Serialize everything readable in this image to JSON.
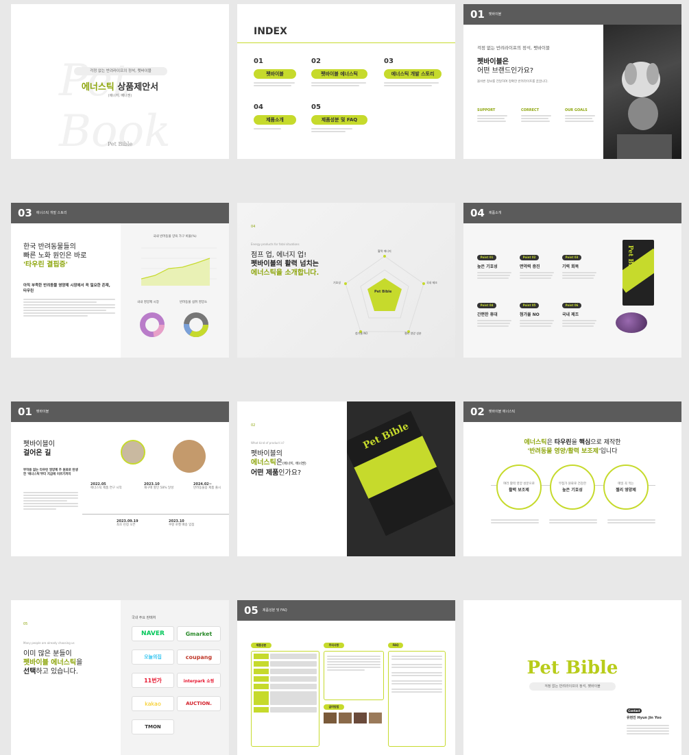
{
  "s1": {
    "tagline": "걱정 없는 반려라이프의 정석, 펫바이블",
    "title_hl": "에너스틱",
    "title_rest": " 상품제안서",
    "subtitle": "(에너지, 에너젠)",
    "brand": "Pet Bible"
  },
  "s2": {
    "title": "INDEX",
    "items": [
      {
        "num": "01",
        "label": "펫바이블"
      },
      {
        "num": "02",
        "label": "펫바이블 에너스틱"
      },
      {
        "num": "03",
        "label": "에너스틱 개발 스토리"
      },
      {
        "num": "04",
        "label": "제품소개"
      },
      {
        "num": "05",
        "label": "제품성분 및 FAQ"
      }
    ]
  },
  "s3": {
    "num": "01",
    "hdr_sub": "펫바이블",
    "tagline": "걱정 없는 반려라이프의 정석, 펫바이블",
    "q1": "펫바이블은",
    "q2": "어떤 브랜드인가요?",
    "desc": "올바른 정보를 전달하여 정확한 반려라이프를 꿈꿉니다.",
    "cols": [
      "SUPPORT",
      "CORRECT",
      "OUR GOALS"
    ]
  },
  "s4": {
    "num": "03",
    "hdr_sub": "에너스틱 개발 스토리",
    "h1": "한국 반려동물들의",
    "h2": "빠른 노화 원인은 바로",
    "h3": "'타우린 결핍증'",
    "sub": "아직 부족한 반려동물 영양제 시장에서 꼭 필요한 존재, 타우린",
    "chart_title": "국내 반려동물 양육 가구 비율(%)",
    "pie1": "국내 영양제 시장",
    "pie2": "반려동물 섭취 영양소"
  },
  "s5": {
    "num": "04",
    "eyebrow": "Energy products for fatal situations",
    "l1": "점프 업, 에너지 업!",
    "l2": "펫바이블의 활력 넘치는",
    "l3": "에너스틱을 소개합니다.",
    "center": "Pet Bible",
    "axes": [
      "활력 에너지",
      "국내 제조",
      "젤리 영양 성분",
      "첨가물 NO",
      "기호성"
    ]
  },
  "s6": {
    "num": "04",
    "hdr_sub": "제품소개",
    "points": [
      {
        "tag": "Point 01",
        "title": "높은 기호성"
      },
      {
        "tag": "Point 02",
        "title": "면역력 증진"
      },
      {
        "tag": "Point 03",
        "title": "기력 회복"
      },
      {
        "tag": "Point 04",
        "title": "간편한 휴대"
      },
      {
        "tag": "Point 05",
        "title": "첨가물 NO"
      },
      {
        "tag": "Point 06",
        "title": "국내 제조"
      }
    ],
    "pkg": "Pet Bible"
  },
  "s7": {
    "num": "01",
    "hdr_sub": "펫바이블",
    "t1": "펫바이블이",
    "t2": "걸어온 길",
    "sub": "부작용 없는 타우린 영양제 주 원료로 탄생한 '에너스틱'부터 지금에 이르기까지",
    "events": [
      {
        "date": "2022.05",
        "text": "에너스틱 제품 연구 시작"
      },
      {
        "date": "2023.10",
        "text": "재구매 할인 58% 달성"
      },
      {
        "date": "2024.02~",
        "text": "반려동물용 제품 출시"
      },
      {
        "date": "2023.09.19",
        "text": "최초 런칭 오픈"
      },
      {
        "date": "2023.10",
        "text": "쿠팡 로켓 배송 입점"
      }
    ]
  },
  "s8": {
    "num": "02",
    "eyebrow": "What kind of product is?",
    "l1": "펫바이블의",
    "l2": "에너스틱",
    "l2b": "은",
    "l2c": "(에너지, 에너젠)",
    "l3": "어떤 제품",
    "l3b": "인가요?",
    "pkg": "Pet Bible"
  },
  "s9": {
    "num": "02",
    "hdr_sub": "펫바이블 에너스틱",
    "h1a": "에너스틱",
    "h1b": "은 ",
    "h1c": "타우린",
    "h1d": "을 ",
    "h1e": "핵심",
    "h1f": "으로 제작한",
    "h2": "'반려동물 영양/활력 보조제'",
    "h2b": "입니다",
    "circles": [
      {
        "sub": "여러 활력 영양 성분으로",
        "title": "활력 보조제"
      },
      {
        "sub": "무첨가 원료로 건강한",
        "title": "높은 기호성"
      },
      {
        "sub": "매일 꼭 먹는",
        "title": "젤리 영양제"
      }
    ]
  },
  "s10": {
    "num": "05",
    "eyebrow": "Many people are already choosing us",
    "l1": "이미 많은 분들이",
    "l2": "펫바이블 에너스틱",
    "l2b": "을",
    "l3": "선택",
    "l3b": "하고 있습니다.",
    "vendor_title": "국내 주요 판매처",
    "vendors": [
      "NAVER",
      "Gmarket",
      "오늘의집",
      "coupang",
      "11번가",
      "interpark 쇼핑",
      "kakao",
      "AUCTION.",
      "TMON"
    ]
  },
  "s11": {
    "num": "05",
    "hdr_sub": "제품성분 및 FAQ",
    "tags": [
      "제품성분",
      "주의사항",
      "FAQ",
      "급여방법"
    ]
  },
  "s12": {
    "brand": "Pet Bible",
    "tagline": "걱정 없는 반려라이프의 정석, 펫바이블",
    "contact_tag": "Contact",
    "name": "유현진 Hyun Jin Yoo"
  },
  "colors": {
    "accent": "#c6da2c",
    "dark": "#5b5b5b"
  }
}
